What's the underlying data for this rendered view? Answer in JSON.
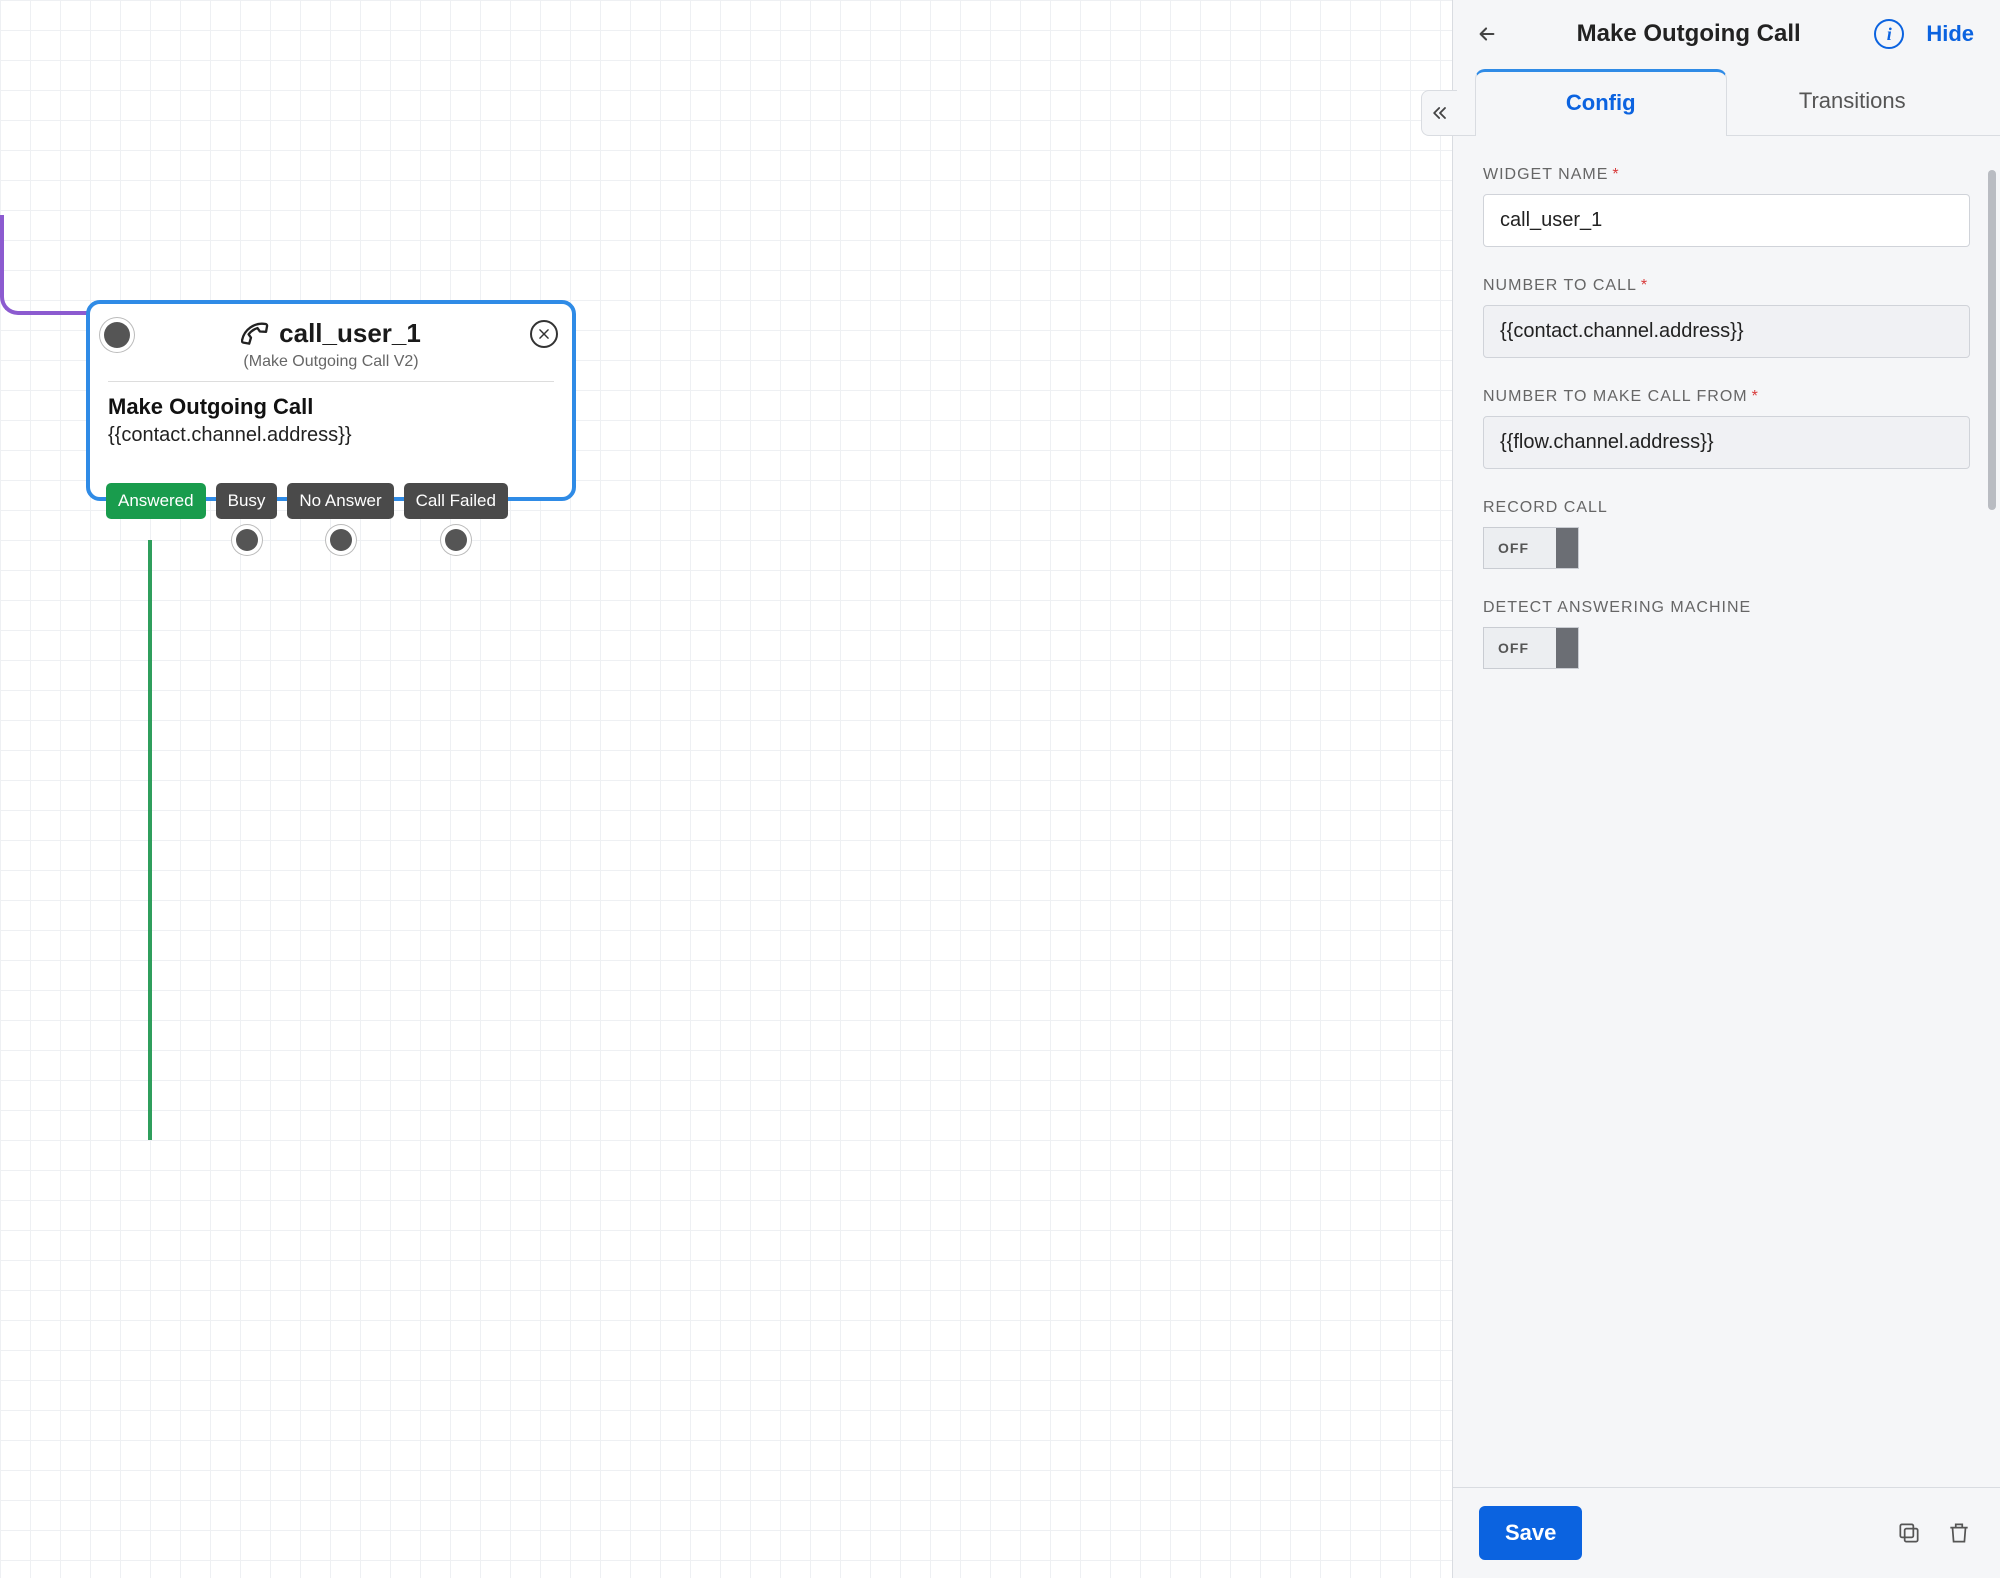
{
  "canvas": {
    "widget": {
      "title": "call_user_1",
      "type_label": "(Make Outgoing Call V2)",
      "action_title": "Make Outgoing Call",
      "action_expr": "{{contact.channel.address}}",
      "outcomes": [
        {
          "label": "Answered",
          "kind": "green"
        },
        {
          "label": "Busy",
          "kind": "dark"
        },
        {
          "label": "No Answer",
          "kind": "dark"
        },
        {
          "label": "Call Failed",
          "kind": "dark"
        }
      ]
    }
  },
  "panel": {
    "title": "Make Outgoing Call",
    "hide_label": "Hide",
    "info_glyph": "i",
    "tabs": {
      "config": "Config",
      "transitions": "Transitions"
    },
    "fields": {
      "widget_name": {
        "label": "WIDGET NAME",
        "value": "call_user_1",
        "required": true
      },
      "number_to_call": {
        "label": "NUMBER TO CALL",
        "value": "{{contact.channel.address}}",
        "required": true
      },
      "number_from": {
        "label": "NUMBER TO MAKE CALL FROM",
        "value": "{{flow.channel.address}}",
        "required": true
      },
      "record_call": {
        "label": "RECORD CALL",
        "value": "OFF"
      },
      "detect_am": {
        "label": "DETECT ANSWERING MACHINE",
        "value": "OFF"
      }
    },
    "save_label": "Save"
  }
}
